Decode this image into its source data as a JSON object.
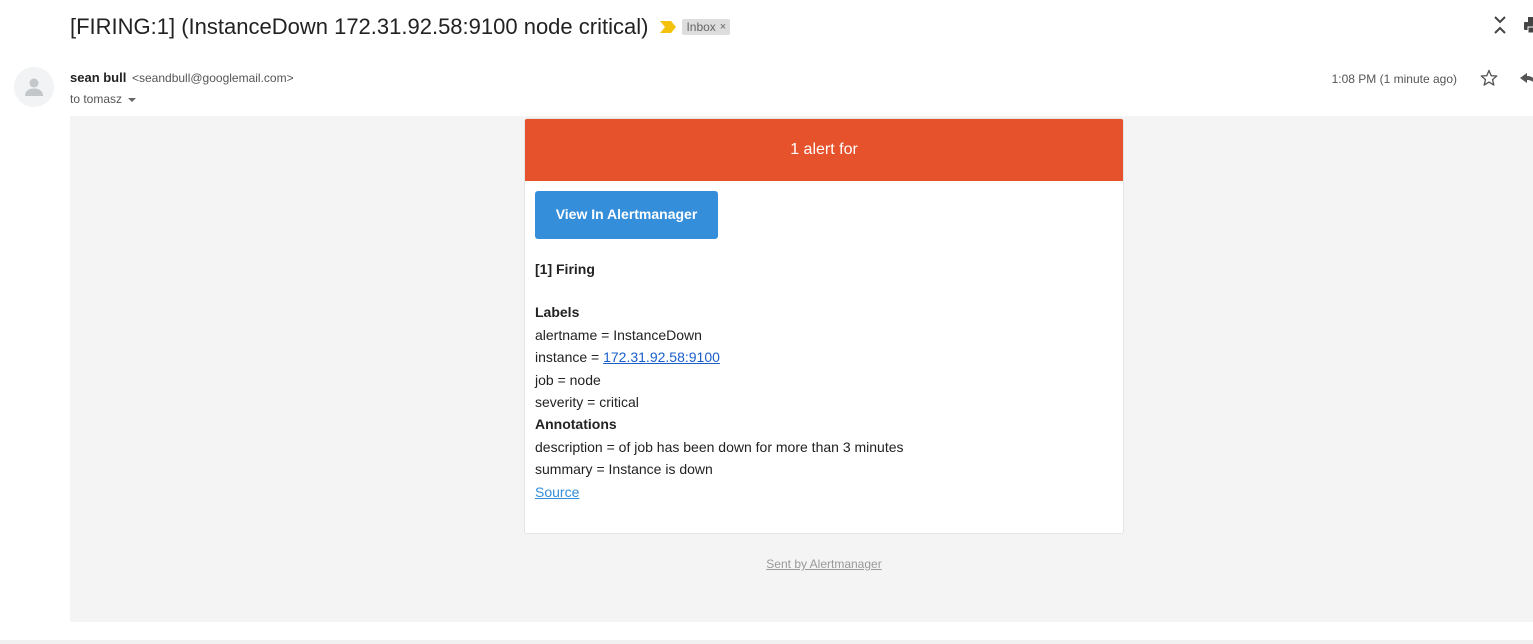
{
  "header": {
    "subject": "[FIRING:1] (InstanceDown 172.31.92.58:9100 node critical)",
    "label_chip": "Inbox",
    "label_chip_close": "×"
  },
  "message": {
    "sender_name": "sean bull",
    "sender_email": "<seandbull@googlemail.com>",
    "to_line": "to tomasz",
    "time": "1:08 PM (1 minute ago)"
  },
  "alert_email": {
    "header_text": "1 alert for",
    "button_label": "View In Alertmanager",
    "firing_title": "[1] Firing",
    "labels_title": "Labels",
    "labels": [
      {
        "prefix": "alertname = ",
        "value": "InstanceDown"
      },
      {
        "prefix": "instance = ",
        "value": "172.31.92.58:9100"
      },
      {
        "prefix": "job = ",
        "value": "node"
      },
      {
        "prefix": "severity = ",
        "value": "critical"
      }
    ],
    "annotations_title": "Annotations",
    "annotations": [
      {
        "prefix": "description = ",
        "value": "of job has been down for more than 3 minutes"
      },
      {
        "prefix": "summary = ",
        "value": "Instance is down"
      }
    ],
    "source_link": "Source",
    "footer": "Sent by Alertmanager"
  },
  "colors": {
    "alert_header": "#e6522c",
    "button": "#348eda",
    "link": "#1a5fcc",
    "email_background": "#f4f4f4",
    "importance_marker": "#f4c20d"
  },
  "icons": {
    "importance": "importance-marker-icon",
    "avatar": "person-avatar-icon",
    "star": "star-icon",
    "reply": "reply-icon",
    "collapse": "collapse-all-icon",
    "print": "print-icon",
    "to_dropdown": "chevron-down-icon"
  }
}
